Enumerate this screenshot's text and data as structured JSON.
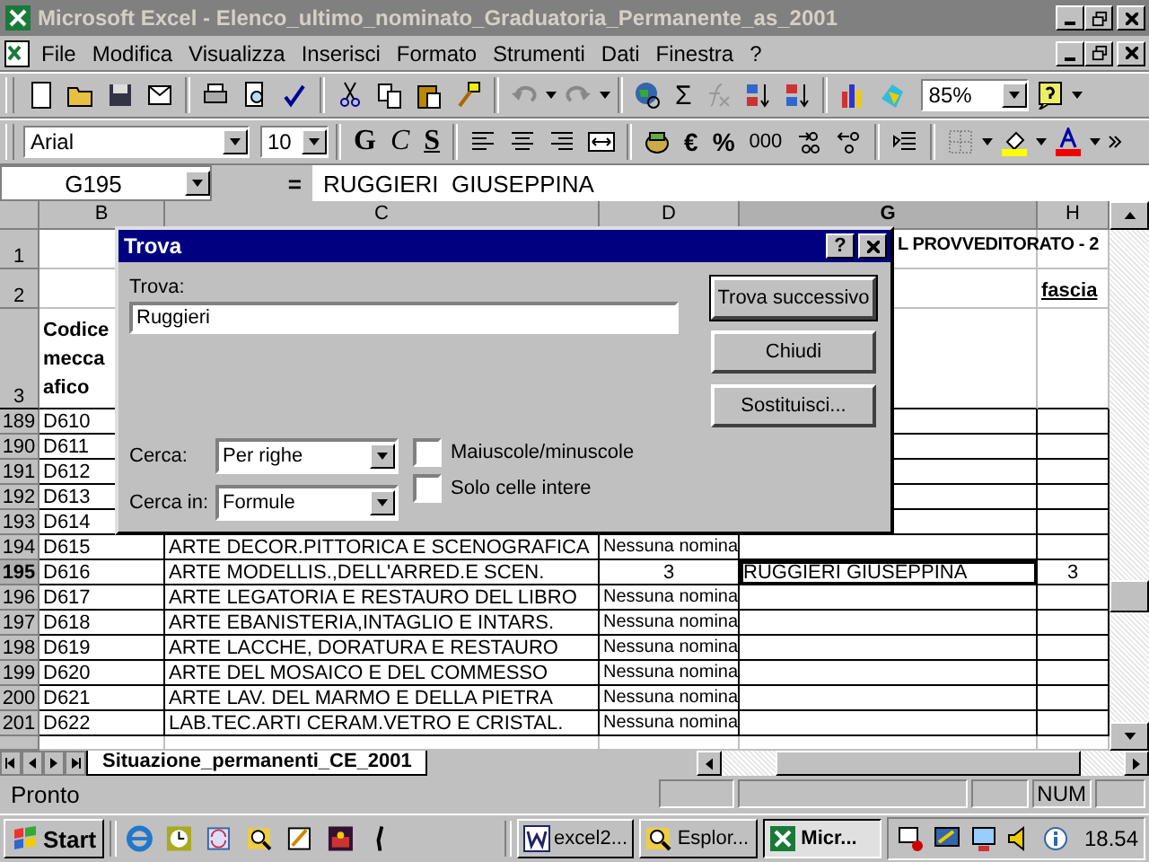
{
  "window": {
    "title": "Microsoft Excel - Elenco_ultimo_nominato_Graduatoria_Permanente_as_2001"
  },
  "menu": [
    {
      "label": "File"
    },
    {
      "label": "Modifica"
    },
    {
      "label": "Visualizza"
    },
    {
      "label": "Inserisci"
    },
    {
      "label": "Formato"
    },
    {
      "label": "Strumenti"
    },
    {
      "label": "Dati"
    },
    {
      "label": "Finestra"
    },
    {
      "label": "?"
    }
  ],
  "standard_toolbar": {
    "sum": "Σ",
    "zoom": "85%"
  },
  "formatting_toolbar": {
    "font": "Arial",
    "size": "10",
    "bold": "G",
    "italic": "C",
    "underline": "S",
    "euro": "€",
    "percent": "%",
    "thousands": "000"
  },
  "formula_bar": {
    "cell": "G195",
    "equals": "=",
    "content": "RUGGIERI  GIUSEPPINA"
  },
  "columns": [
    {
      "label": "B",
      "selected": false
    },
    {
      "label": "C",
      "selected": false
    },
    {
      "label": "D",
      "selected": false
    },
    {
      "label": "G",
      "selected": true
    },
    {
      "label": "H",
      "selected": false
    }
  ],
  "rows": [
    {
      "header": "1",
      "selected": false,
      "kind": "title",
      "g": "L PROVVEDITORATO - 2"
    },
    {
      "header": "2",
      "selected": false,
      "kind": "title",
      "h": "fascia"
    },
    {
      "header": "3",
      "selected": false,
      "kind": "heading",
      "b": "Codice\nmecca\nafico"
    },
    {
      "header": "189",
      "selected": false,
      "kind": "data",
      "b": "D610"
    },
    {
      "header": "190",
      "selected": false,
      "kind": "data",
      "b": "D611"
    },
    {
      "header": "191",
      "selected": false,
      "kind": "data",
      "b": "D612"
    },
    {
      "header": "192",
      "selected": false,
      "kind": "data",
      "b": "D613"
    },
    {
      "header": "193",
      "selected": false,
      "kind": "data",
      "b": "D614"
    },
    {
      "header": "194",
      "selected": false,
      "kind": "data",
      "b": "D615",
      "c": "ARTE DECOR.PITTORICA E SCENOGRAFICA",
      "d": "Nessuna nomina"
    },
    {
      "header": "195",
      "selected": true,
      "kind": "data",
      "b": "D616",
      "c": "ARTE MODELLIS.,DELL'ARRED.E SCEN.",
      "d": "3",
      "g": "RUGGIERI  GIUSEPPINA",
      "h": "3"
    },
    {
      "header": "196",
      "selected": false,
      "kind": "data",
      "b": "D617",
      "c": "ARTE LEGATORIA E RESTAURO DEL LIBRO",
      "d": "Nessuna nomina"
    },
    {
      "header": "197",
      "selected": false,
      "kind": "data",
      "b": "D618",
      "c": "ARTE EBANISTERIA,INTAGLIO E INTARS.",
      "d": "Nessuna nomina"
    },
    {
      "header": "198",
      "selected": false,
      "kind": "data",
      "b": "D619",
      "c": "ARTE LACCHE, DORATURA E RESTAURO",
      "d": "Nessuna nomina"
    },
    {
      "header": "199",
      "selected": false,
      "kind": "data",
      "b": "D620",
      "c": "ARTE DEL MOSAICO E DEL COMMESSO",
      "d": "Nessuna nomina"
    },
    {
      "header": "200",
      "selected": false,
      "kind": "data",
      "b": "D621",
      "c": "ARTE LAV. DEL MARMO E DELLA PIETRA",
      "d": "Nessuna nomina"
    },
    {
      "header": "201",
      "selected": false,
      "kind": "data",
      "b": "D622",
      "c": "LAB.TEC.ARTI CERAM.VETRO E CRISTAL.",
      "d": "Nessuna nomina"
    }
  ],
  "dialog": {
    "title": "Trova",
    "help": "?",
    "find_label": "Trova:",
    "find_value": "Ruggieri",
    "buttons": [
      {
        "label": "Trova successivo",
        "default": true
      },
      {
        "label": "Chiudi",
        "default": false
      },
      {
        "label": "Sostituisci...",
        "default": false
      }
    ],
    "search_label": "Cerca:",
    "search_value": "Per righe",
    "look_in_label": "Cerca in:",
    "look_in_value": "Formule",
    "options": [
      {
        "label": "Maiuscole/minuscole",
        "checked": false
      },
      {
        "label": "Solo celle intere",
        "checked": false
      }
    ]
  },
  "sheet_tabs": [
    {
      "label": "Situazione_permanenti_CE_2001",
      "selected": true
    }
  ],
  "status_bar": {
    "status": "Pronto",
    "num": "NUM"
  },
  "taskbar": {
    "start": "Start",
    "tasks": [
      {
        "label": "excel2...",
        "selected": false
      },
      {
        "label": "Esplor...",
        "selected": false
      },
      {
        "label": "Micr...",
        "selected": true
      }
    ],
    "clock": "18.54"
  }
}
